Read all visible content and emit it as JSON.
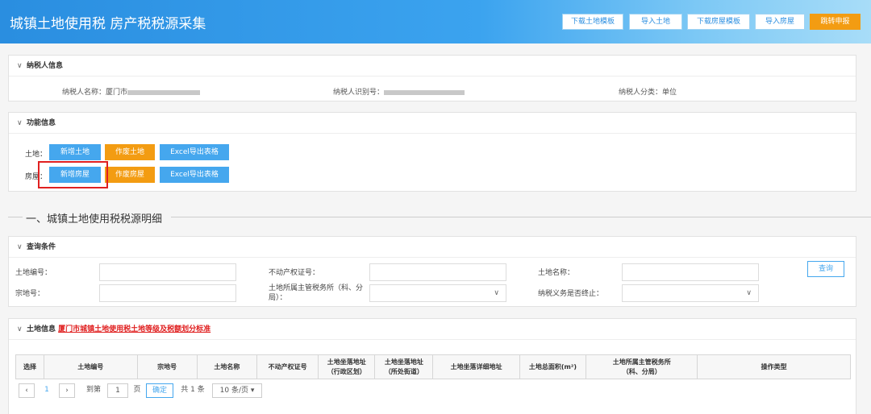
{
  "header": {
    "title": "城镇土地使用税 房产税税源采集",
    "buttons": {
      "download_land_template": "下载土地模板",
      "import_land": "导入土地",
      "download_house_template": "下载房屋模板",
      "import_house": "导入房屋",
      "jump_declare": "跳转申报"
    }
  },
  "taxpayer_panel": {
    "title": "纳税人信息",
    "name_label": "纳税人名称：厦门市",
    "id_label": "纳税人识别号：",
    "type_label": "纳税人分类：单位"
  },
  "function_panel": {
    "title": "功能信息",
    "land_label": "土地：",
    "house_label": "房屋：",
    "land_buttons": {
      "add": "新增土地",
      "void": "作废土地",
      "export": "Excel导出表格"
    },
    "house_buttons": {
      "add": "新增房屋",
      "void": "作废房屋",
      "export": "Excel导出表格"
    }
  },
  "section": {
    "title": "一、城镇土地使用税税源明细"
  },
  "query_panel": {
    "title": "查询条件",
    "fields": {
      "land_no": "土地编号：",
      "cert_no": "不动产权证号：",
      "land_name": "土地名称：",
      "parcel_no": "宗地号：",
      "tax_office": "土地所属主管税务所（科、分局）：",
      "obligation_end": "纳税义务是否终止："
    },
    "query_button": "查询"
  },
  "land_panel": {
    "title": "土地信息",
    "link": "厦门市城镇土地使用税土地等级及税额划分标准",
    "columns": [
      "选择",
      "土地编号",
      "宗地号",
      "土地名称",
      "不动产权证号",
      "土地坐落地址\n（行政区划）",
      "土地坐落地址\n（所处街道）",
      "土地坐落详细地址",
      "土地总面积(m²)",
      "土地所属主管税务所\n（科、分局）",
      "操作类型"
    ]
  },
  "pager": {
    "prev": "‹",
    "page": "1",
    "next": "›",
    "goto_label": "到第",
    "goto_value": "1",
    "page_unit": "页",
    "confirm": "确定",
    "total": "共 1 条",
    "page_size": "10 条/页"
  },
  "colors": {
    "accent": "#45a7ee",
    "orange": "#f39c12",
    "highlight": "#e02020"
  }
}
